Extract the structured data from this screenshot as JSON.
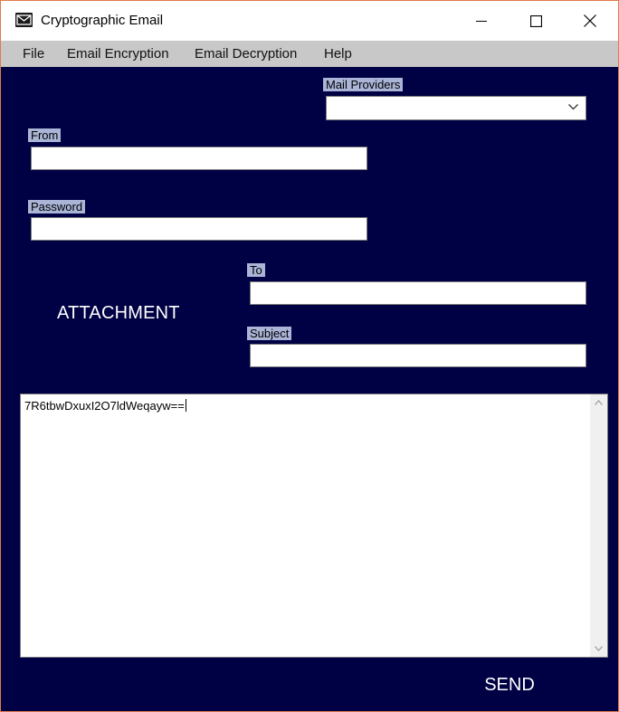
{
  "window": {
    "title": "Cryptographic Email",
    "icon": "envelope-icon"
  },
  "menu": {
    "items": [
      "File",
      "Email Encryption",
      "Email Decryption",
      "Help"
    ]
  },
  "form": {
    "mail_providers": {
      "label": "Mail Providers",
      "value": ""
    },
    "from": {
      "label": "From",
      "value": ""
    },
    "password": {
      "label": "Password",
      "value": ""
    },
    "to": {
      "label": "To",
      "value": ""
    },
    "subject": {
      "label": "Subject",
      "value": ""
    },
    "attachment_label": "ATTACHMENT",
    "message_body": "7R6tbwDxuxI2O7ldWeqayw==",
    "send_label": "SEND"
  },
  "colors": {
    "panel_bg": "#000044",
    "label_bg": "#a9b4d6",
    "menubar_bg": "#c8c8c8",
    "window_border": "#e07a4a"
  }
}
